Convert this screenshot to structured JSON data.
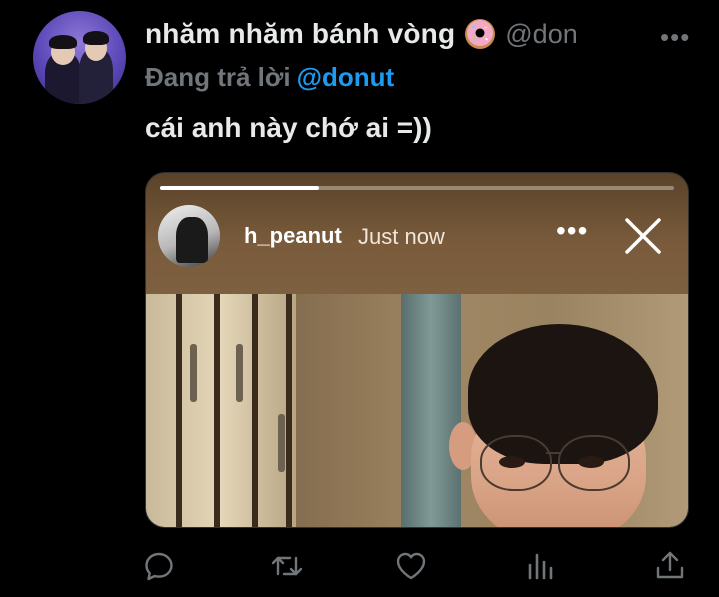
{
  "author": {
    "display_name": "nhăm nhăm bánh vòng",
    "emoji_icon": "donut-icon",
    "handle": "@don"
  },
  "reply": {
    "prefix": "Đang trả lời",
    "mention": "@donut"
  },
  "tweet": {
    "text": "cái anh này chớ ai =))"
  },
  "story": {
    "username": "h_peanut",
    "time": "Just now",
    "progress_fraction": 0.31,
    "more_label": "•••",
    "close_icon": "close-icon"
  },
  "top_more_label": "•••",
  "actions": [
    {
      "icon": "reply-icon"
    },
    {
      "icon": "retweet-icon"
    },
    {
      "icon": "like-icon"
    },
    {
      "icon": "analytics-icon"
    },
    {
      "icon": "share-icon"
    }
  ],
  "colors": {
    "background": "#000000",
    "text_primary": "#e7e9ea",
    "text_secondary": "#71767b",
    "accent": "#1d9bf0"
  }
}
